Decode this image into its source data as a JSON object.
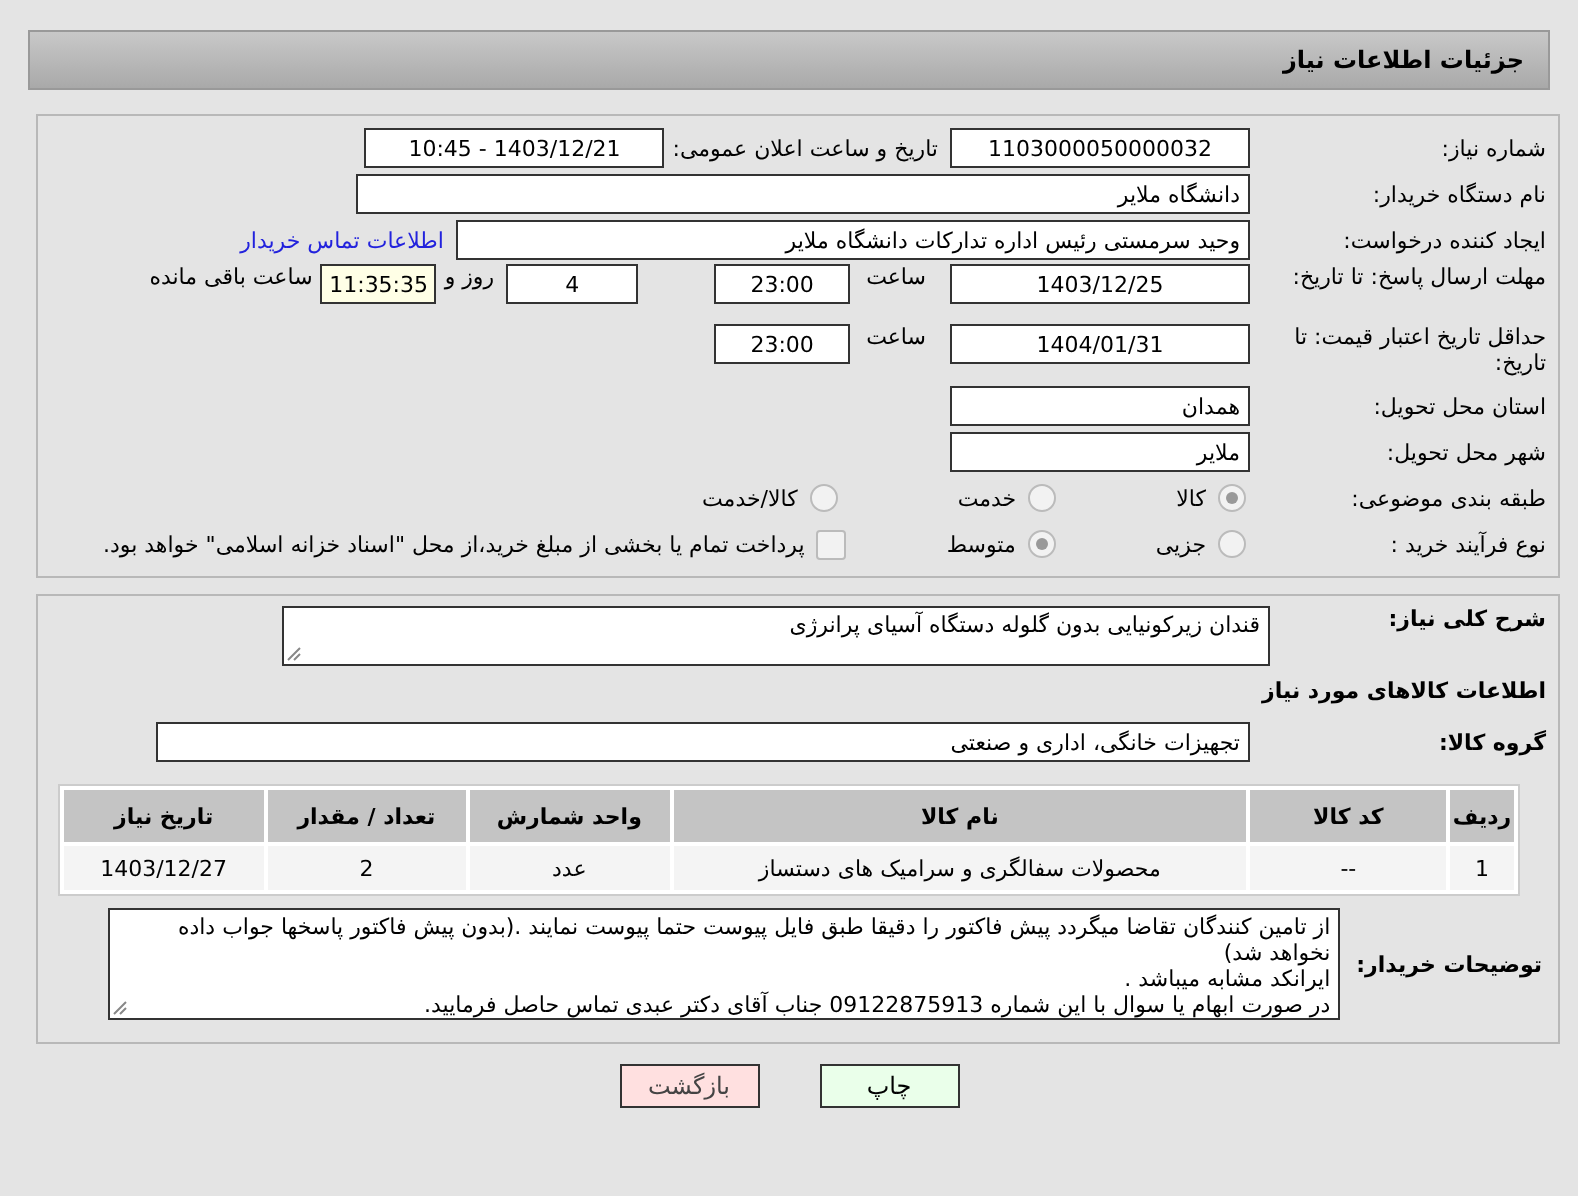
{
  "header": {
    "title": "جزئیات اطلاعات نیاز"
  },
  "need_number": {
    "label": "شماره نیاز:",
    "value": "1103000050000032"
  },
  "announce": {
    "label": "تاریخ و ساعت اعلان عمومی:",
    "value": "1403/12/21 - 10:45"
  },
  "buyer_org": {
    "label": "نام دستگاه خریدار:",
    "value": "دانشگاه ملایر"
  },
  "requester": {
    "label": "ایجاد کننده درخواست:",
    "value": "وحید سرمستی رئیس اداره تدارکات دانشگاه ملایر",
    "link": "اطلاعات تماس خریدار"
  },
  "reply_deadline": {
    "label": "مهلت ارسال پاسخ: تا تاریخ:",
    "date": "1403/12/25",
    "time_label": "ساعت",
    "time": "23:00",
    "days": "4",
    "days_label": "روز و",
    "remaining": "11:35:35",
    "remaining_label": "ساعت باقی مانده"
  },
  "price_validity": {
    "label": "حداقل تاریخ اعتبار قیمت: تا تاریخ:",
    "date": "1404/01/31",
    "time_label": "ساعت",
    "time": "23:00"
  },
  "province": {
    "label": "استان محل تحویل:",
    "value": "همدان"
  },
  "city": {
    "label": "شهر محل تحویل:",
    "value": "ملایر"
  },
  "category": {
    "label": "طبقه بندی موضوعی:",
    "options": [
      {
        "label": "کالا",
        "selected": true
      },
      {
        "label": "خدمت",
        "selected": false
      },
      {
        "label": "کالا/خدمت",
        "selected": false
      }
    ]
  },
  "process": {
    "label": "نوع فرآیند خرید :",
    "options": [
      {
        "label": "جزیی",
        "selected": false
      },
      {
        "label": "متوسط",
        "selected": true
      }
    ],
    "payment": {
      "label": "پرداخت تمام یا بخشی از مبلغ خرید،از محل \"اسناد خزانه اسلامی\" خواهد بود.",
      "checked": false
    }
  },
  "description": {
    "label": "شرح کلی نیاز:",
    "value": "قندان زیرکونیایی بدون گلوله دستگاه آسیای پرانرژی"
  },
  "goods_title": "اطلاعات کالاهای مورد نیاز",
  "goods_group": {
    "label": "گروه کالا:",
    "value": "تجهیزات خانگی، اداری و صنعتی"
  },
  "table": {
    "columns": [
      "ردیف",
      "کد کالا",
      "نام کالا",
      "واحد شمارش",
      "تعداد / مقدار",
      "تاریخ نیاز"
    ],
    "rows": [
      [
        "1",
        "--",
        "محصولات سفالگری و سرامیک های دستساز",
        "عدد",
        "2",
        "1403/12/27"
      ]
    ]
  },
  "buyer_notes": {
    "label": "توضیحات خریدار:",
    "lines": [
      "از تامین کنندگان تقاضا میگردد پیش فاکتور را دقیقا طبق فایل پیوست حتما پیوست نمایند .(بدون پیش فاکتور پاسخها جواب داده نخواهد شد)",
      "ایرانکد مشابه میباشد .",
      "در صورت ابهام یا سوال با این شماره 09122875913 جناب آقای دکتر عبدی تماس حاصل فرمایید."
    ]
  },
  "buttons": [
    {
      "label": "چاپ",
      "kind": "print"
    },
    {
      "label": "بازگشت",
      "kind": "back"
    }
  ]
}
